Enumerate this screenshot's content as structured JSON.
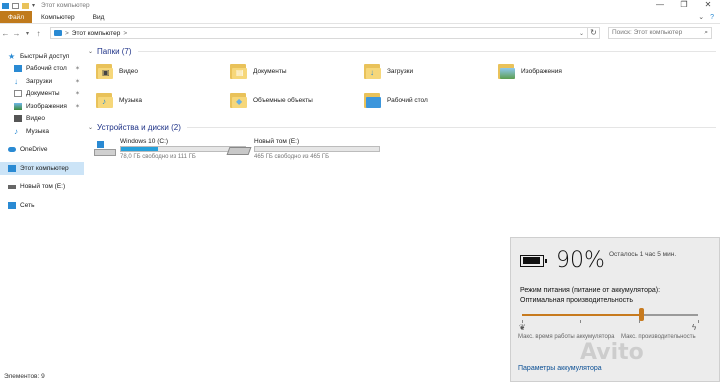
{
  "window": {
    "title": "Этот компьютер",
    "controls": [
      "—",
      "❐",
      "✕"
    ]
  },
  "ribbon": {
    "tabs": [
      "Файл",
      "Компьютер",
      "Вид"
    ]
  },
  "address": {
    "path_label": "Этот компьютер",
    "separator": ">",
    "search_placeholder": "Поиск: Этот компьютер"
  },
  "sidebar": {
    "quick_access": "Быстрый доступ",
    "quick_items": [
      "Рабочий стол",
      "Загрузки",
      "Документы",
      "Изображения",
      "Видео",
      "Музыка"
    ],
    "onedrive": "OneDrive",
    "this_pc": "Этот компьютер",
    "new_volume": "Новый том (E:)",
    "network": "Сеть"
  },
  "groups": {
    "folders_header": "Папки (7)",
    "drives_header": "Устройства и диски (2)"
  },
  "folders": [
    "Видео",
    "Документы",
    "Загрузки",
    "Изображения",
    "Музыка",
    "Объемные объекты",
    "Рабочий стол"
  ],
  "drives": [
    {
      "name": "Windows 10 (C:)",
      "free_text": "78,0 ГБ свободно из 111 ГБ",
      "used_fraction": 0.3
    },
    {
      "name": "Новый том (E:)",
      "free_text": "465 ГБ свободно из 465 ГБ",
      "used_fraction": 0.0
    }
  ],
  "status": {
    "items": "Элементов: 9"
  },
  "battery": {
    "percent_text": "90%",
    "percent": 90,
    "remaining": "Осталось 1 час 5 мин.",
    "mode_title": "Режим питания (питание от аккумулятора):",
    "mode_value": "Оптимальная производительность",
    "slider_position": 0.68,
    "slider_left_label": "Макс. время работы аккумулятора",
    "slider_right_label": "Макс. производительность",
    "settings_link": "Параметры аккумулятора"
  },
  "colors": {
    "accent": "#c77a1e",
    "selection": "#cce4f7",
    "drive_fill": "#26a0da",
    "header_text": "#1e3287"
  }
}
